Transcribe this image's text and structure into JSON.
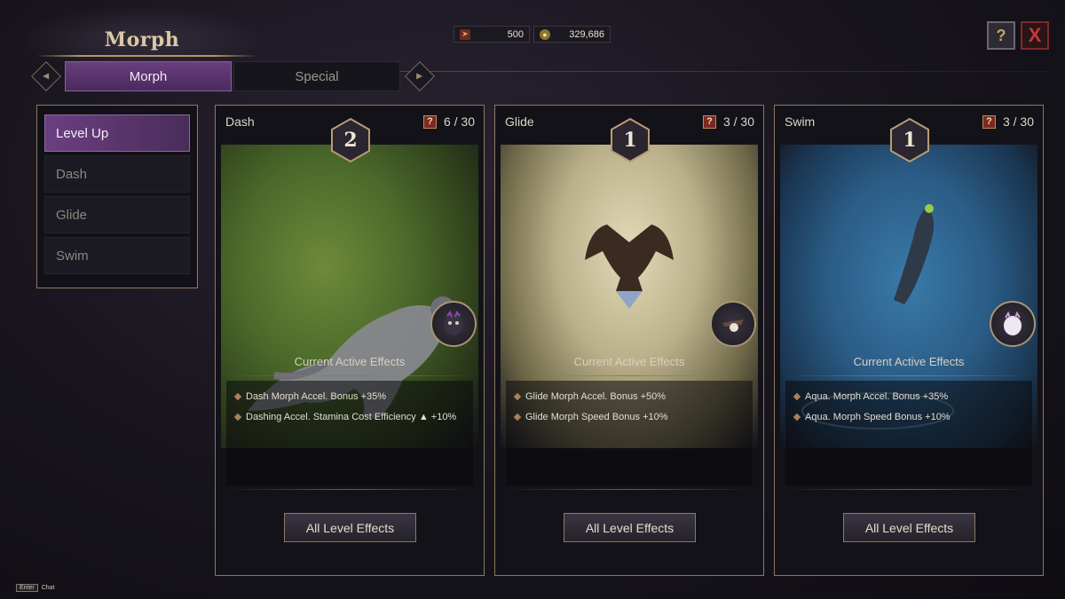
{
  "header": {
    "title": "Morph",
    "currency": [
      {
        "icon": "energy-icon",
        "value": "500"
      },
      {
        "icon": "silver-coin-icon",
        "value": "329,686"
      }
    ],
    "help_label": "?",
    "close_label": "X"
  },
  "tabs": [
    {
      "label": "Morph",
      "active": true
    },
    {
      "label": "Special",
      "active": false
    }
  ],
  "sidebar": {
    "items": [
      {
        "label": "Level Up",
        "active": true
      },
      {
        "label": "Dash",
        "active": false
      },
      {
        "label": "Glide",
        "active": false
      },
      {
        "label": "Swim",
        "active": false
      }
    ]
  },
  "cards": [
    {
      "name": "Dash",
      "level": "2",
      "progress": "6 / 30",
      "progress_icon": "?",
      "effects_title": "Current Active Effects",
      "effects": [
        "Dash Morph Accel. Bonus +35%",
        "Dashing Accel. Stamina Cost Efficiency ▲ +10%"
      ],
      "button": "All Level Effects"
    },
    {
      "name": "Glide",
      "level": "1",
      "progress": "3 / 30",
      "progress_icon": "?",
      "effects_title": "Current Active Effects",
      "effects": [
        "Glide Morph Accel. Bonus +50%",
        "Glide Morph Speed Bonus +10%"
      ],
      "button": "All Level Effects"
    },
    {
      "name": "Swim",
      "level": "1",
      "progress": "3 / 30",
      "progress_icon": "?",
      "effects_title": "Current Active Effects",
      "effects": [
        "Aqua. Morph Accel. Bonus +35%",
        "Aqua. Morph Speed Bonus +10%"
      ],
      "button": "All Level Effects"
    }
  ],
  "footer": {
    "key": "Enter",
    "label": "Chat"
  },
  "colors": {
    "accent_purple": "#6a3e7e",
    "gold_border": "#8b7a62",
    "close_red": "#c23a3a"
  }
}
